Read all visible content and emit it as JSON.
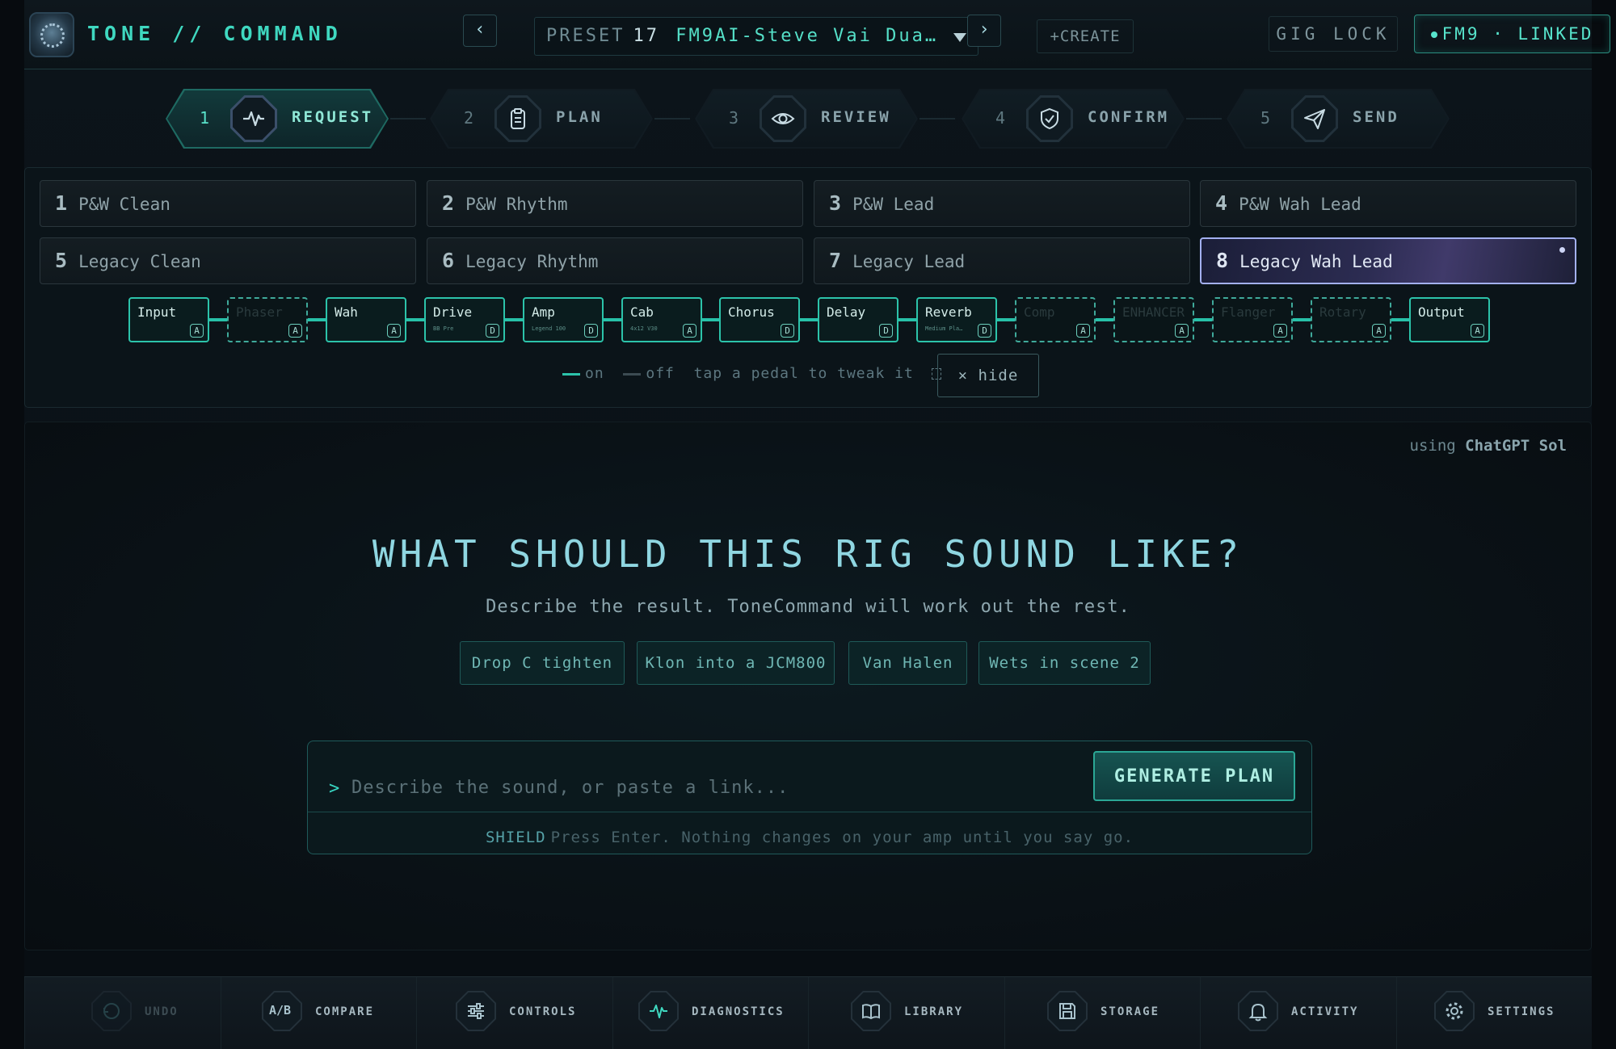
{
  "app": {
    "title": "TONE // COMMAND",
    "colors": {
      "accent": "#3fd8c0",
      "background": "#0a1117",
      "active_scene": "#a3b0f0"
    }
  },
  "header": {
    "prev_icon": "chevron-left-icon",
    "next_icon": "chevron-right-icon",
    "preset_label": "PRESET",
    "preset_number": "17",
    "preset_name": "FM9AI-Steve Vai Dua…",
    "create_label": "+CREATE",
    "gig_lock_label": "GIG LOCK",
    "device_status": "FM9 · LINKED"
  },
  "steps": [
    {
      "num": "1",
      "label": "REQUEST",
      "icon": "pulse-icon",
      "active": true
    },
    {
      "num": "2",
      "label": "PLAN",
      "icon": "clipboard-icon",
      "active": false
    },
    {
      "num": "3",
      "label": "REVIEW",
      "icon": "eye-icon",
      "active": false
    },
    {
      "num": "4",
      "label": "CONFIRM",
      "icon": "shield-check-icon",
      "active": false
    },
    {
      "num": "5",
      "label": "SEND",
      "icon": "paper-plane-icon",
      "active": false
    }
  ],
  "scenes": [
    {
      "num": "1",
      "name": "P&W Clean"
    },
    {
      "num": "2",
      "name": "P&W Rhythm"
    },
    {
      "num": "3",
      "name": "P&W Lead"
    },
    {
      "num": "4",
      "name": "P&W Wah Lead"
    },
    {
      "num": "5",
      "name": "Legacy Clean"
    },
    {
      "num": "6",
      "name": "Legacy Rhythm"
    },
    {
      "num": "7",
      "name": "Legacy Lead"
    },
    {
      "num": "8",
      "name": "Legacy Wah Lead",
      "active": true
    }
  ],
  "chain": [
    {
      "name": "Input",
      "sub": "",
      "badge": "A",
      "on": true
    },
    {
      "name": "Phaser",
      "sub": "",
      "badge": "A",
      "on": false
    },
    {
      "name": "Wah",
      "sub": "",
      "badge": "A",
      "on": true
    },
    {
      "name": "Drive",
      "sub": "BB Pre",
      "badge": "D",
      "on": true
    },
    {
      "name": "Amp",
      "sub": "Legend 100",
      "badge": "D",
      "on": true
    },
    {
      "name": "Cab",
      "sub": "4x12 V30",
      "badge": "A",
      "on": true
    },
    {
      "name": "Chorus",
      "sub": "",
      "badge": "D",
      "on": true
    },
    {
      "name": "Delay",
      "sub": "",
      "badge": "D",
      "on": true
    },
    {
      "name": "Reverb",
      "sub": "Medium Pla…",
      "badge": "D",
      "on": true
    },
    {
      "name": "Comp",
      "sub": "",
      "badge": "A",
      "on": false
    },
    {
      "name": "ENHANCER",
      "sub": "",
      "badge": "A",
      "on": false
    },
    {
      "name": "Flanger",
      "sub": "",
      "badge": "A",
      "on": false
    },
    {
      "name": "Rotary",
      "sub": "",
      "badge": "A",
      "on": false
    },
    {
      "name": "Output",
      "sub": "",
      "badge": "A",
      "on": true
    }
  ],
  "chain_legend": {
    "on_label": "on",
    "off_label": "off",
    "hint": "tap a pedal to tweak it",
    "expand_icon": "expand-icon",
    "hide_label": "× hide"
  },
  "main": {
    "model_prefix": "using",
    "model_name": "ChatGPT Sol",
    "headline": "WHAT SHOULD THIS RIG SOUND LIKE?",
    "subline": "Describe the result. ToneCommand will work out the rest.",
    "suggestions": [
      "Drop C tighten",
      "Klon into a JCM800",
      "Van Halen",
      "Wets in scene 2"
    ],
    "prompt_caret": ">",
    "prompt_placeholder": "Describe the sound, or paste a link...",
    "generate_label": "GENERATE PLAN",
    "hint_tag": "SHIELD",
    "hint_text": "Press Enter. Nothing changes on your amp until you say go."
  },
  "dock": [
    {
      "label": "UNDO",
      "icon": "undo-icon",
      "disabled": true
    },
    {
      "label": "COMPARE",
      "icon": "ab-compare-icon",
      "icon_text": "A/B"
    },
    {
      "label": "CONTROLS",
      "icon": "sliders-icon"
    },
    {
      "label": "DIAGNOSTICS",
      "icon": "pulse-icon"
    },
    {
      "label": "LIBRARY",
      "icon": "book-icon"
    },
    {
      "label": "STORAGE",
      "icon": "floppy-disk-icon"
    },
    {
      "label": "ACTIVITY",
      "icon": "bell-icon"
    },
    {
      "label": "SETTINGS",
      "icon": "gear-icon"
    }
  ]
}
